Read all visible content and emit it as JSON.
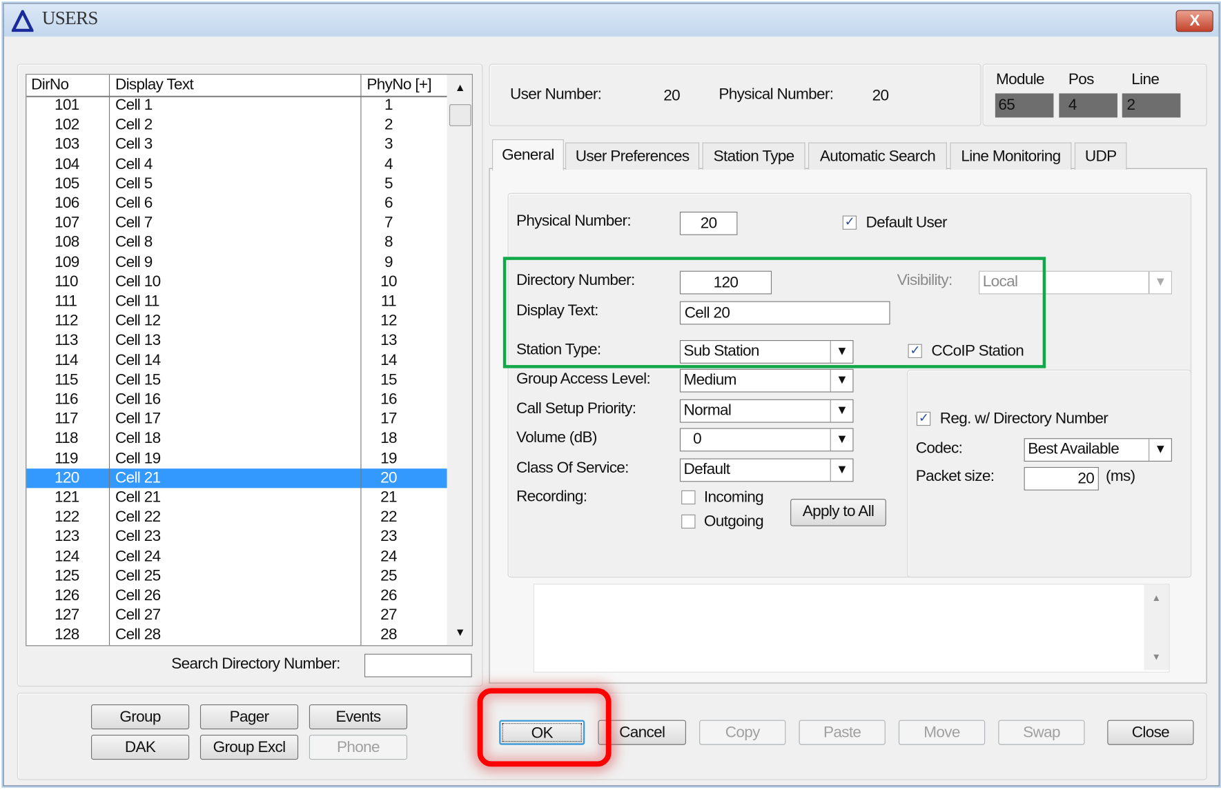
{
  "window": {
    "title": "USERS",
    "close_label": "X"
  },
  "list": {
    "columns": [
      "DirNo",
      "Display Text",
      "PhyNo [+]"
    ],
    "rows": [
      [
        "101",
        "Cell 1",
        "1"
      ],
      [
        "102",
        "Cell 2",
        "2"
      ],
      [
        "103",
        "Cell 3",
        "3"
      ],
      [
        "104",
        "Cell 4",
        "4"
      ],
      [
        "105",
        "Cell 5",
        "5"
      ],
      [
        "106",
        "Cell 6",
        "6"
      ],
      [
        "107",
        "Cell 7",
        "7"
      ],
      [
        "108",
        "Cell 8",
        "8"
      ],
      [
        "109",
        "Cell 9",
        "9"
      ],
      [
        "110",
        "Cell 10",
        "10"
      ],
      [
        "111",
        "Cell 11",
        "11"
      ],
      [
        "112",
        "Cell 12",
        "12"
      ],
      [
        "113",
        "Cell 13",
        "13"
      ],
      [
        "114",
        "Cell 14",
        "14"
      ],
      [
        "115",
        "Cell 15",
        "15"
      ],
      [
        "116",
        "Cell 16",
        "16"
      ],
      [
        "117",
        "Cell 17",
        "17"
      ],
      [
        "118",
        "Cell 18",
        "18"
      ],
      [
        "119",
        "Cell 19",
        "19"
      ],
      [
        "120",
        "Cell 21",
        "20"
      ],
      [
        "121",
        "Cell 21",
        "21"
      ],
      [
        "122",
        "Cell 22",
        "22"
      ],
      [
        "123",
        "Cell 23",
        "23"
      ],
      [
        "124",
        "Cell 24",
        "24"
      ],
      [
        "125",
        "Cell 25",
        "25"
      ],
      [
        "126",
        "Cell 26",
        "26"
      ],
      [
        "127",
        "Cell 27",
        "27"
      ],
      [
        "128",
        "Cell 28",
        "28"
      ]
    ],
    "selected_index": 19,
    "search_label": "Search Directory Number:",
    "search_value": ""
  },
  "info": {
    "user_number_label": "User Number:",
    "user_number": "20",
    "physical_number_label": "Physical Number:",
    "physical_number": "20",
    "module_label": "Module",
    "pos_label": "Pos",
    "line_label": "Line",
    "module": "65",
    "pos": "4",
    "line": "2"
  },
  "tabs": [
    "General",
    "User Preferences",
    "Station Type",
    "Automatic Search",
    "Line Monitoring",
    "UDP"
  ],
  "general": {
    "physical_number_label": "Physical Number:",
    "physical_number": "20",
    "default_user_label": "Default User",
    "default_user": true,
    "directory_number_label": "Directory Number:",
    "directory_number": "120",
    "visibility_label": "Visibility:",
    "visibility": "Local",
    "display_text_label": "Display Text:",
    "display_text": "Cell 20",
    "station_type_label": "Station Type:",
    "station_type": "Sub Station",
    "ccoip_label": "CCoIP Station",
    "ccoip": true,
    "group_access_label": "Group Access Level:",
    "group_access": "Medium",
    "call_setup_label": "Call Setup Priority:",
    "call_setup": "Normal",
    "volume_label": "Volume (dB)",
    "volume": "0",
    "cos_label": "Class Of Service:",
    "cos": "Default",
    "recording_label": "Recording:",
    "incoming_label": "Incoming",
    "outgoing_label": "Outgoing",
    "apply_all_label": "Apply to All",
    "reg_label": "Reg. w/ Directory Number",
    "reg": true,
    "codec_label": "Codec:",
    "codec": "Best Available",
    "packet_label": "Packet size:",
    "packet": "20",
    "packet_unit": "(ms)"
  },
  "buttons": {
    "group": "Group",
    "pager": "Pager",
    "events": "Events",
    "dak": "DAK",
    "group_excl": "Group Excl",
    "phone": "Phone",
    "ok": "OK",
    "cancel": "Cancel",
    "copy": "Copy",
    "paste": "Paste",
    "move": "Move",
    "swap": "Swap",
    "close": "Close"
  },
  "colors": {
    "highlight_green": "#12a84a",
    "highlight_red": "#ff0000",
    "selection": "#3399ff"
  }
}
